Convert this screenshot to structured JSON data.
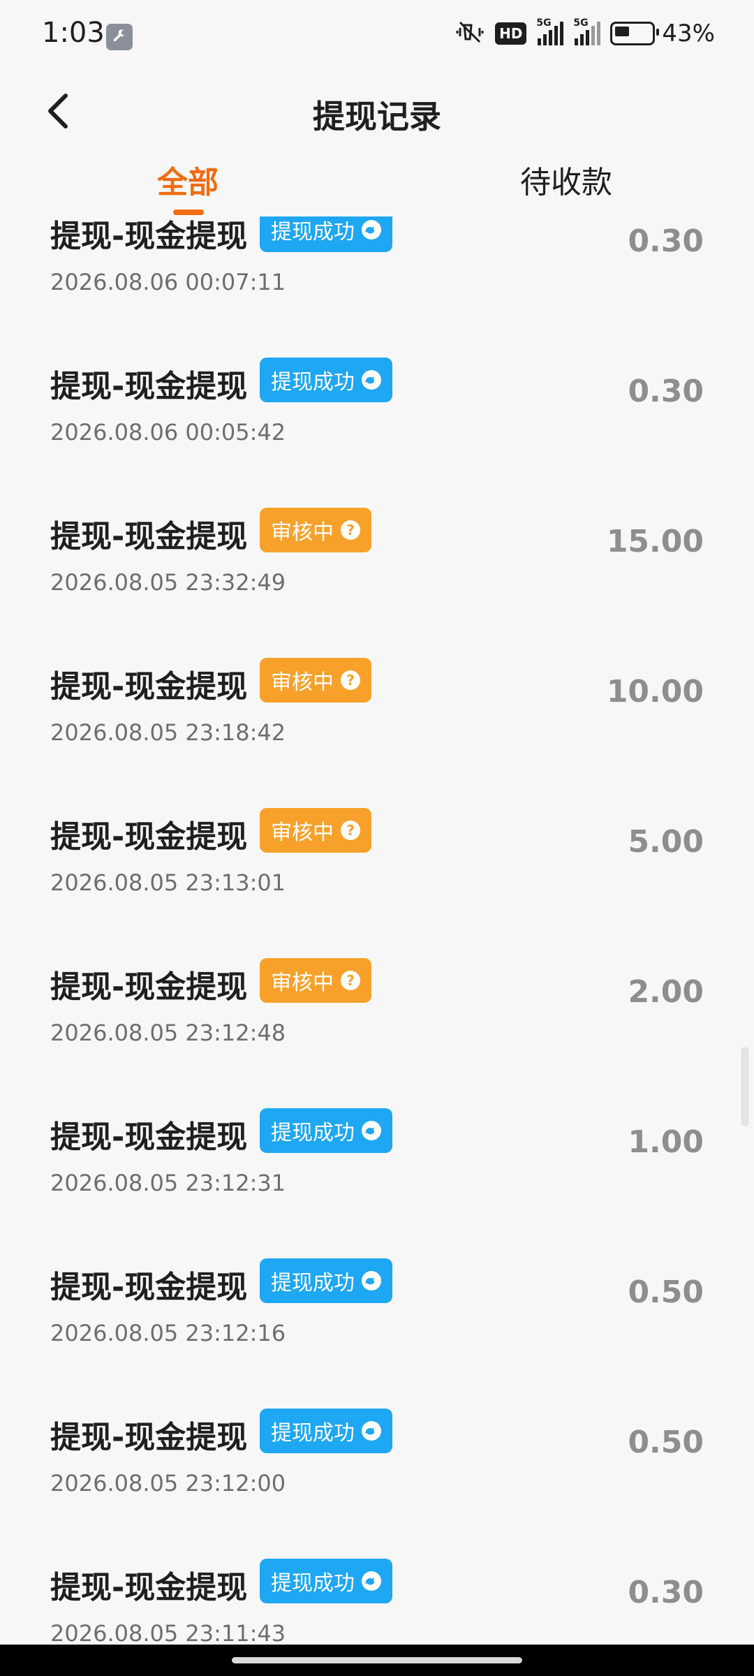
{
  "status_bar": {
    "time": "1:03",
    "network_1": "5G",
    "network_2": "5G",
    "hd": "HD",
    "battery": "43%"
  },
  "header": {
    "title": "提现记录"
  },
  "tabs": [
    {
      "label": "全部",
      "active": true
    },
    {
      "label": "待收款",
      "active": false
    }
  ],
  "records": [
    {
      "title": "提现-现金提现",
      "status": "提现成功",
      "status_type": "success",
      "time": "2026.08.06 00:07:11",
      "amount": "0.30"
    },
    {
      "title": "提现-现金提现",
      "status": "提现成功",
      "status_type": "success",
      "time": "2026.08.06 00:05:42",
      "amount": "0.30"
    },
    {
      "title": "提现-现金提现",
      "status": "审核中",
      "status_type": "review",
      "time": "2026.08.05 23:32:49",
      "amount": "15.00"
    },
    {
      "title": "提现-现金提现",
      "status": "审核中",
      "status_type": "review",
      "time": "2026.08.05 23:18:42",
      "amount": "10.00"
    },
    {
      "title": "提现-现金提现",
      "status": "审核中",
      "status_type": "review",
      "time": "2026.08.05 23:13:01",
      "amount": "5.00"
    },
    {
      "title": "提现-现金提现",
      "status": "审核中",
      "status_type": "review",
      "time": "2026.08.05 23:12:48",
      "amount": "2.00"
    },
    {
      "title": "提现-现金提现",
      "status": "提现成功",
      "status_type": "success",
      "time": "2026.08.05 23:12:31",
      "amount": "1.00"
    },
    {
      "title": "提现-现金提现",
      "status": "提现成功",
      "status_type": "success",
      "time": "2026.08.05 23:12:16",
      "amount": "0.50"
    },
    {
      "title": "提现-现金提现",
      "status": "提现成功",
      "status_type": "success",
      "time": "2026.08.05 23:12:00",
      "amount": "0.50"
    },
    {
      "title": "提现-现金提现",
      "status": "提现成功",
      "status_type": "success",
      "time": "2026.08.05 23:11:43",
      "amount": "0.30"
    }
  ],
  "colors": {
    "accent": "#f06d13",
    "success_badge": "#1ea7f2",
    "review_badge": "#f7a12a"
  },
  "icons": {
    "back": "chevron-left-icon",
    "success": "chat-bubble-icon",
    "review": "question-circle-icon"
  }
}
